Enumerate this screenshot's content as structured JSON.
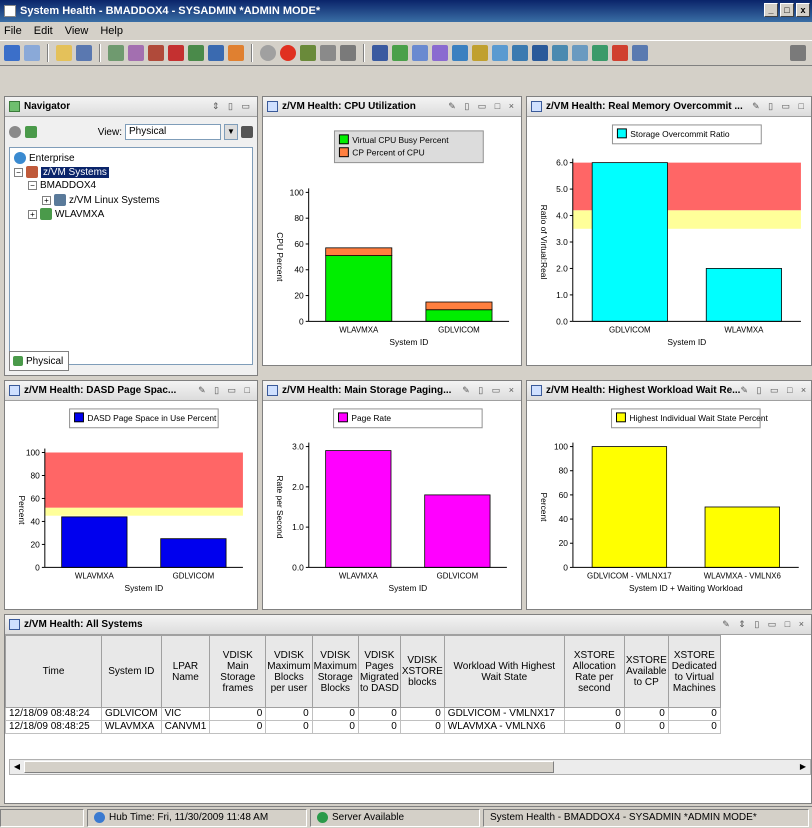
{
  "window": {
    "title": "System Health - BMADDOX4 - SYSADMIN *ADMIN MODE*"
  },
  "menu": [
    "File",
    "Edit",
    "View",
    "Help"
  ],
  "navigator": {
    "title": "Navigator",
    "view_label": "View:",
    "view_value": "Physical",
    "tree": [
      "Enterprise",
      "z/VM Systems",
      "BMADDOX4",
      "z/VM Linux Systems",
      "WLAVMXA"
    ],
    "tab_label": "Physical"
  },
  "panels": {
    "cpu": "z/VM Health: CPU Utilization",
    "memory": "z/VM Health: Real Memory Overcommit ...",
    "dasd": "z/VM Health: DASD Page Spac...",
    "paging": "z/VM Health: Main Storage Paging...",
    "wait": "z/VM Health: Highest Workload Wait Re...",
    "table": "z/VM Health: All Systems"
  },
  "chart_data": [
    {
      "id": "cpu",
      "type": "bar",
      "stacked": true,
      "categories": [
        "WLAVMXA",
        "GDLVICOM"
      ],
      "series": [
        {
          "name": "Virtual CPU Busy Percent",
          "values": [
            51,
            9
          ],
          "color": "#00ee00"
        },
        {
          "name": "CP Percent of CPU",
          "values": [
            6,
            6
          ],
          "color": "#ff7f3f"
        }
      ],
      "ylabel": "CPU Percent",
      "xlabel": "System ID",
      "ylim": [
        0,
        100
      ],
      "yticks": [
        "0",
        "20",
        "40",
        "60",
        "80",
        "100"
      ],
      "legend_position": "top"
    },
    {
      "id": "memory",
      "type": "bar",
      "categories": [
        "GDLVICOM",
        "WLAVMXA"
      ],
      "series": [
        {
          "name": "Storage Overcommit Ratio",
          "values": [
            6.0,
            2.0
          ],
          "color": "#00ffff"
        }
      ],
      "ylabel": "Ratio of Virtual:Real",
      "xlabel": "System ID",
      "ylim": [
        0,
        6.0
      ],
      "yticks": [
        "0.0",
        "1.0",
        "2.0",
        "3.0",
        "4.0",
        "5.0",
        "6.0"
      ],
      "thresholds": {
        "warning": [
          3.5,
          4.2
        ],
        "critical": [
          4.2,
          6.0
        ]
      },
      "legend_position": "top"
    },
    {
      "id": "dasd",
      "type": "bar",
      "categories": [
        "WLAVMXA",
        "GDLVICOM"
      ],
      "series": [
        {
          "name": "DASD Page Space in Use Percent",
          "values": [
            44,
            25
          ],
          "color": "#0000ee"
        }
      ],
      "ylabel": "Percent",
      "xlabel": "System ID",
      "ylim": [
        0,
        100
      ],
      "yticks": [
        "0",
        "20",
        "40",
        "60",
        "80",
        "100"
      ],
      "thresholds": {
        "warning": [
          45,
          52
        ],
        "critical": [
          52,
          100
        ]
      },
      "legend_position": "top"
    },
    {
      "id": "paging",
      "type": "bar",
      "categories": [
        "WLAVMXA",
        "GDLVICOM"
      ],
      "series": [
        {
          "name": "Page Rate",
          "values": [
            2.9,
            1.8
          ],
          "color": "#ff00ff"
        }
      ],
      "ylabel": "Rate per Second",
      "xlabel": "System ID",
      "ylim": [
        0,
        3.0
      ],
      "yticks": [
        "0.0",
        "1.0",
        "2.0",
        "3.0"
      ],
      "legend_position": "top"
    },
    {
      "id": "wait",
      "type": "bar",
      "categories": [
        "GDLVICOM - VMLNX17",
        "WLAVMXA - VMLNX6"
      ],
      "series": [
        {
          "name": "Highest Individual Wait State Percent",
          "values": [
            100,
            50
          ],
          "color": "#ffff00"
        }
      ],
      "ylabel": "Percent",
      "xlabel": "System ID + Waiting Workload",
      "ylim": [
        0,
        100
      ],
      "yticks": [
        "0",
        "20",
        "40",
        "60",
        "80",
        "100"
      ],
      "legend_position": "top"
    }
  ],
  "table": {
    "columns": [
      "Time",
      "System ID",
      "LPAR Name",
      "VDISK Main Storage frames",
      "VDISK Maximum Blocks per user",
      "VDISK Maximum Storage Blocks",
      "VDISK Pages Migrated to DASD",
      "VDISK XSTORE blocks",
      "Workload With Highest Wait State",
      "XSTORE Allocation Rate per second",
      "XSTORE Available to CP",
      "XSTORE Dedicated to Virtual Machines"
    ],
    "rows": [
      [
        "12/18/09 08:48:24",
        "GDLVICOM",
        "VIC",
        "0",
        "0",
        "0",
        "0",
        "0",
        "GDLVICOM - VMLNX17",
        "0",
        "0",
        "0"
      ],
      [
        "12/18/09 08:48:25",
        "WLAVMXA",
        "CANVM1",
        "0",
        "0",
        "0",
        "0",
        "0",
        "WLAVMXA - VMLNX6",
        "0",
        "0",
        "0"
      ]
    ]
  },
  "status": {
    "hub_time": "Hub Time: Fri, 11/30/2009 11:48 AM",
    "server": "Server Available",
    "title": "System Health - BMADDOX4 - SYSADMIN *ADMIN MODE*"
  },
  "colors": {
    "warning_band": "#ffff99",
    "critical_band": "#ff6666",
    "title_bar": "#0a246a"
  }
}
